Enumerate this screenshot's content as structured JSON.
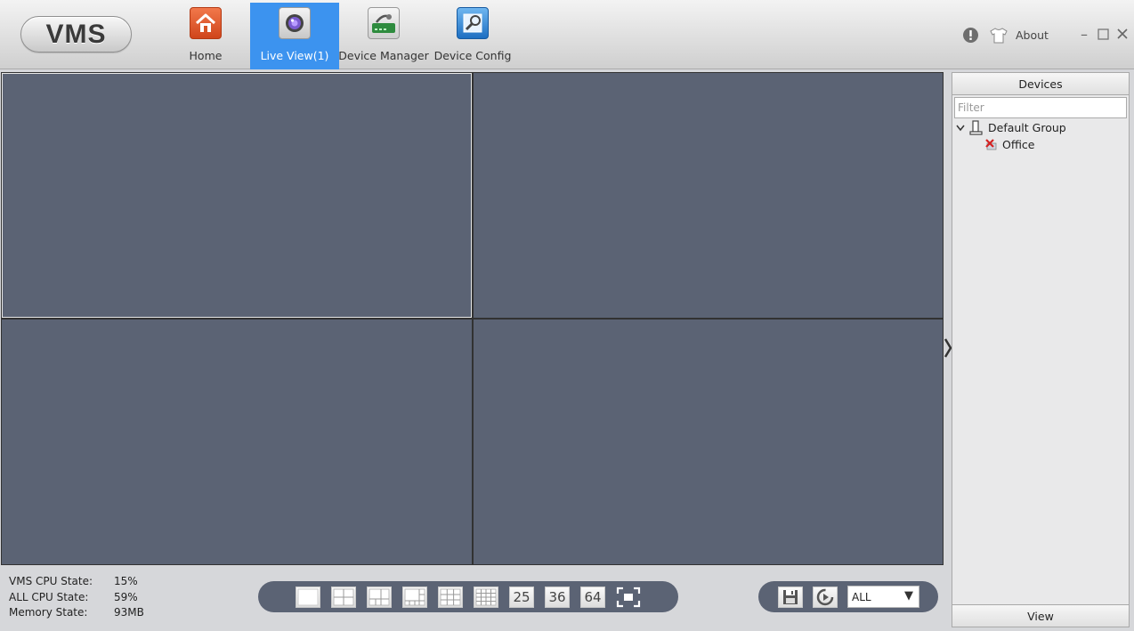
{
  "app": {
    "logo_text": "VMS"
  },
  "nav": [
    {
      "label": "Home",
      "icon": "home-icon",
      "active": false
    },
    {
      "label": "Live View(1)",
      "icon": "camera-lens-icon",
      "active": true
    },
    {
      "label": "Device Manager",
      "icon": "device-manager-icon",
      "active": false
    },
    {
      "label": "Device Config",
      "icon": "device-config-icon",
      "active": false
    }
  ],
  "header": {
    "about_label": "About"
  },
  "panel": {
    "title": "Devices",
    "filter_placeholder": "Filter",
    "tree": {
      "group": "Default Group",
      "devices": [
        {
          "name": "Office",
          "status": "offline"
        }
      ]
    },
    "footer": "View"
  },
  "status": {
    "vms_cpu_label": "VMS CPU State:",
    "vms_cpu_value": "15%",
    "all_cpu_label": "ALL CPU State:",
    "all_cpu_value": "59%",
    "memory_label": "Memory State:",
    "memory_value": "93MB"
  },
  "layout_toolbar": {
    "n25": "25",
    "n36": "36",
    "n64": "64"
  },
  "stream_select": {
    "value": "ALL"
  },
  "colors": {
    "accent": "#3c93ef",
    "video_bg": "#5b6374",
    "toolbar_bg": "#5b6374"
  }
}
